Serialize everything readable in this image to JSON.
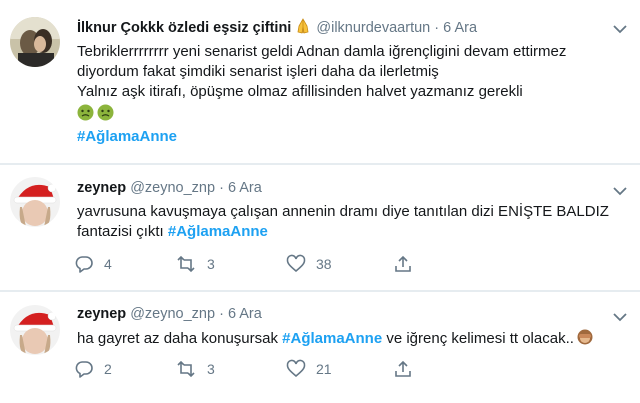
{
  "tweets": [
    {
      "name": "İlknur Çokkk özledi eşsiz çiftini",
      "name_emoji": "folded-hands-icon",
      "handle": "@ilknurdevaartun",
      "separator": "·",
      "date": "6 Ara",
      "lines": [
        "Tebriklerrrrrrrr yeni senarist geldi Adnan damla iğrençligini devam ettirmez",
        "diyordum fakat şimdiki senarist işleri daha da ilerletmiş",
        "Yalnız aşk itirafı, öpüşme olmaz afillisinden halvet yazmanız gerekli"
      ],
      "emojis": [
        "nauseated-face-icon",
        "nauseated-face-icon"
      ],
      "hashtag": "#AğlamaAnne"
    },
    {
      "name": "zeynep",
      "handle": "@zeyno_znp",
      "separator": "·",
      "date": "6 Ara",
      "line1": "yavrusuna kavuşmaya çalışan annenin dramı diye tanıtılan dizi ENİŞTE BALDIZ",
      "line2_prefix": "fantazisi çıktı ",
      "hashtag": "#AğlamaAnne",
      "replies": "4",
      "retweets": "3",
      "likes": "38"
    },
    {
      "name": "zeynep",
      "handle": "@zeyno_znp",
      "separator": "·",
      "date": "6 Ara",
      "prefix": "ha gayret az daha konuşursak ",
      "hashtag": "#AğlamaAnne",
      "suffix": " ve iğrenç kelimesi tt olacak..",
      "trailing_emoji": "see-no-evil-monkey-icon",
      "replies": "2",
      "retweets": "3",
      "likes": "21"
    }
  ]
}
